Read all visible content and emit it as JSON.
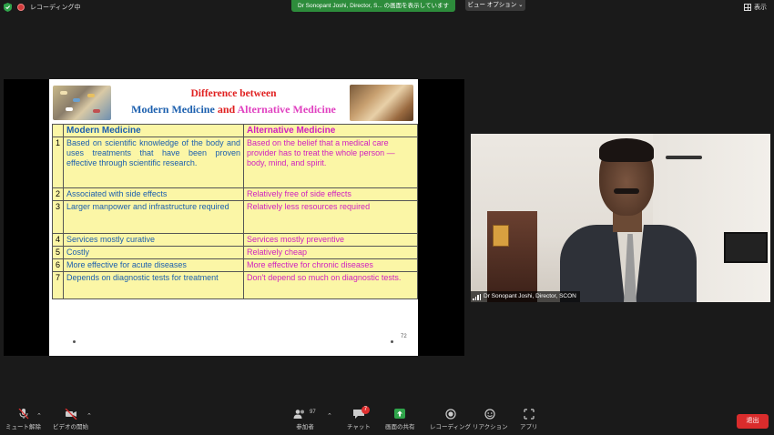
{
  "topbar": {
    "recording_label": "レコーディング中",
    "share_banner": "Dr Sonopant Joshi, Director, S... の画面を表示しています",
    "view_options": "ビュー オプション",
    "display_label": "表示"
  },
  "slide": {
    "title_line1": "Difference between",
    "title_mm": "Modern Medicine",
    "title_and": "and",
    "title_am": "Alternative Medicine",
    "headers": {
      "modern": "Modern  Medicine",
      "alternative": "Alternative Medicine"
    },
    "rows": [
      {
        "num": "1",
        "modern": "Based on scientific knowledge of the body  and uses treatments that have been proven   effective  through scientific research.",
        "alternative": "Based on the belief that a medical care  provider has to treat the whole person —  body, mind, and spirit."
      },
      {
        "num": "2",
        "modern": "Associated with side effects",
        "alternative": "Relatively free of side effects"
      },
      {
        "num": "3",
        "modern": "Larger manpower and infrastructure  required",
        "alternative": "Relatively less resources required"
      },
      {
        "num": "4",
        "modern": "Services mostly curative",
        "alternative": "Services mostly preventive"
      },
      {
        "num": "5",
        "modern": "Costly",
        "alternative": "Relatively cheap"
      },
      {
        "num": "6",
        "modern": "More effective for acute diseases",
        "alternative": "More effective for chronic diseases"
      },
      {
        "num": "7",
        "modern": "Depends on diagnostic tests for treatment",
        "alternative": "Don't depend so much on diagnostic tests."
      }
    ],
    "page_number": "72"
  },
  "video": {
    "participant_name": "Dr Sonopant Joshi, Director, SCON"
  },
  "toolbar": {
    "mute_label": "ミュート解除",
    "video_label": "ビデオの開始",
    "participants_label": "参加者",
    "participants_count": "97",
    "chat_label": "チャット",
    "chat_badge": "7",
    "share_label": "画面の共有",
    "record_label": "レコーディング",
    "reactions_label": "リアクション",
    "apps_label": "アプリ",
    "leave_label": "退出"
  },
  "colors": {
    "share_green": "#2d8c3b",
    "leave_red": "#d92c2c",
    "modern_blue": "#1b5fae",
    "alternative_magenta": "#d020c0",
    "table_yellow": "#fbf6a6"
  }
}
